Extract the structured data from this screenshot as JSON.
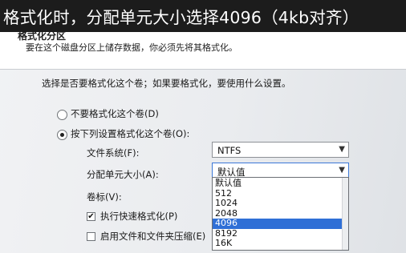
{
  "caption": "格式化时，分配单元大小选择4096（4kb对齐）",
  "dialog": {
    "title": "格式化分区",
    "subtitle": "要在这个磁盘分区上储存数据，你必须先将其格式化。",
    "prompt": "选择是否要格式化这个卷；如果要格式化，要使用什么设置。"
  },
  "options": {
    "no_format": "不要格式化这个卷(D)",
    "format": "按下列设置格式化这个卷(O):"
  },
  "fields": {
    "file_system_label": "文件系统(F):",
    "file_system_value": "NTFS",
    "alloc_label": "分配单元大小(A):",
    "alloc_value": "默认值",
    "volume_label": "卷标(V):"
  },
  "dropdown_items": [
    "默认值",
    "512",
    "1024",
    "2048",
    "4096",
    "8192",
    "16K"
  ],
  "dropdown_selected_index": 4,
  "checks": {
    "quick_format": "执行快速格式化(P)",
    "compression": "启用文件和文件夹压缩(E)"
  },
  "icons": {
    "dropdown_arrow": "chevron-down-icon",
    "check_mark": "checkmark-icon"
  },
  "colors": {
    "selection": "#2f6fd6",
    "caption_bg": "#1c1c1c"
  }
}
